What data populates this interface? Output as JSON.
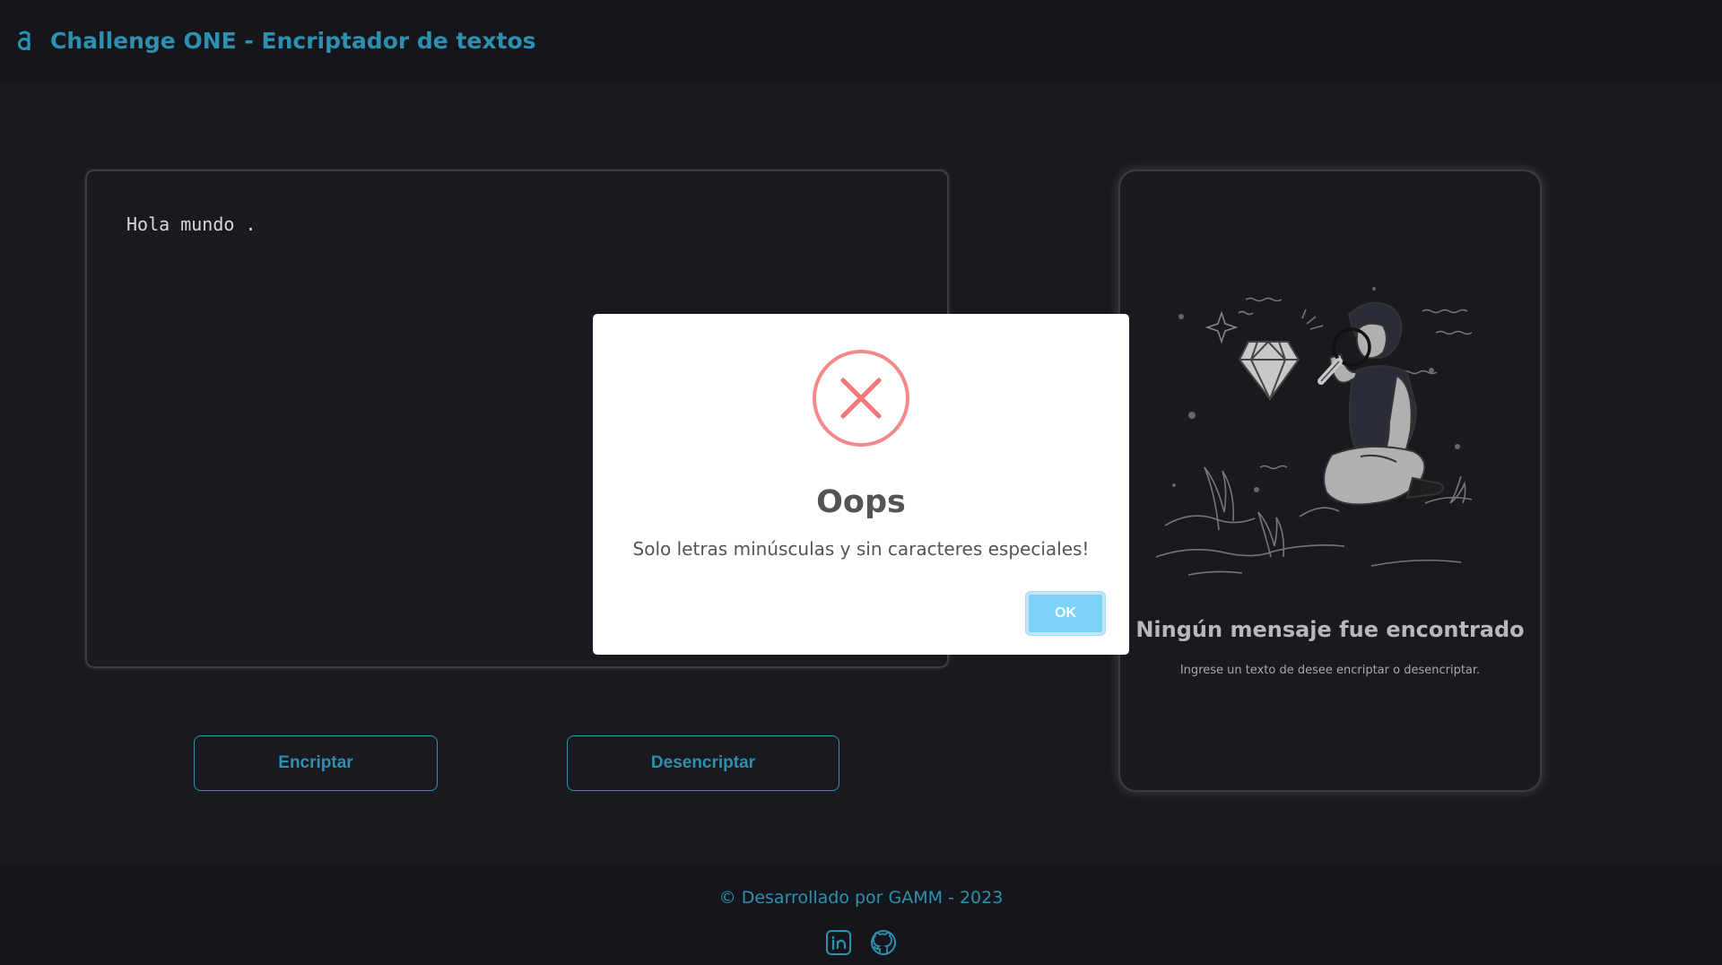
{
  "header": {
    "title": "Challenge ONE - Encriptador de textos",
    "logo_icon": "alura-logo-icon"
  },
  "input": {
    "value": "Hola mundo ."
  },
  "actions": {
    "encrypt_label": "Encriptar",
    "decrypt_label": "Desencriptar"
  },
  "output": {
    "title": "Ningún mensaje fue encontrado",
    "subtitle": "Ingrese un texto de desee encriptar o desencriptar.",
    "illustration": "person-with-magnifier-and-diamond"
  },
  "footer": {
    "text": "© Desarrollado por GAMM - 2023",
    "links": [
      "linkedin-icon",
      "github-icon"
    ]
  },
  "modal": {
    "icon": "error-x-icon",
    "title": "Oops",
    "message": "Solo letras minúsculas y sin caracteres especiales!",
    "ok_label": "OK"
  },
  "colors": {
    "accent": "#2e90b0",
    "background": "#181a20",
    "error": "#f27474",
    "ok_button": "#7cd1f9"
  }
}
